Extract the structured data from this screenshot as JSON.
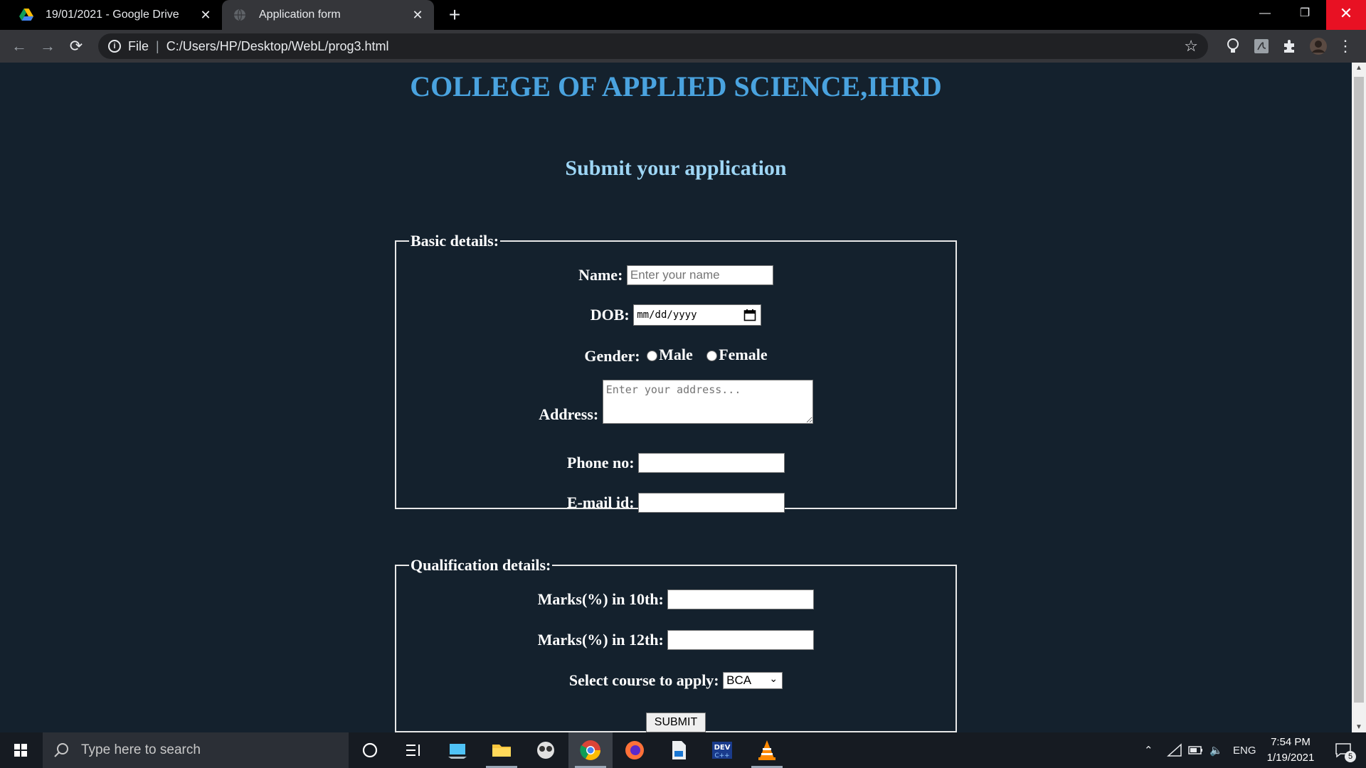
{
  "browser": {
    "tabs": [
      {
        "title": "19/01/2021 - Google Drive",
        "active": false
      },
      {
        "title": "Application form",
        "active": true
      }
    ],
    "url_scheme": "File",
    "url": "C:/Users/HP/Desktop/WebL/prog3.html"
  },
  "page": {
    "heading": "COLLEGE OF APPLIED SCIENCE,IHRD",
    "subheading": "Submit your application",
    "basic": {
      "legend": "Basic details:",
      "name_label": "Name:",
      "name_placeholder": "Enter your name",
      "dob_label": "DOB:",
      "dob_placeholder": "mm/dd/yyyy",
      "gender_label": "Gender:",
      "gender_options": [
        "Male",
        "Female"
      ],
      "address_label": "Address:",
      "address_placeholder": "Enter your address...",
      "phone_label": "Phone no:",
      "email_label": "E-mail id:"
    },
    "qualification": {
      "legend": "Qualification details:",
      "marks10_label": "Marks(%) in 10th:",
      "marks12_label": "Marks(%) in 12th:",
      "course_label": "Select course to apply:",
      "course_selected": "BCA"
    },
    "submit_label": "SUBMIT"
  },
  "taskbar": {
    "search_placeholder": "Type here to search",
    "language": "ENG",
    "time": "7:54 PM",
    "date": "1/19/2021",
    "notification_count": "5"
  },
  "colors": {
    "page_bg": "#14212d",
    "heading": "#4aa3df",
    "subheading": "#9ed6f5",
    "close_button": "#e81123"
  }
}
